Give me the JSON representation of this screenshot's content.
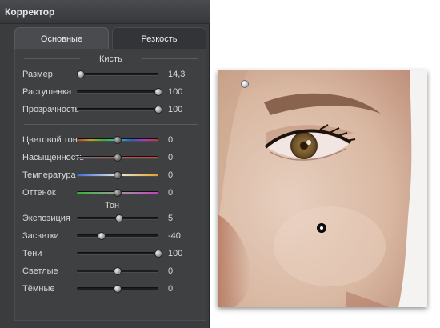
{
  "app": {
    "title": "Корректор"
  },
  "tabs": [
    {
      "label": "Основные",
      "active": true
    },
    {
      "label": "Резкость",
      "active": false
    }
  ],
  "sections": {
    "brush": "Кисть",
    "tone": "Тон"
  },
  "brush_rows": [
    {
      "label": "Размер",
      "value": "14,3",
      "level": 0.05
    },
    {
      "label": "Растушевка",
      "value": "100",
      "level": 1.0
    },
    {
      "label": "Прозрачность",
      "value": "100",
      "level": 1.0
    }
  ],
  "color_rows": [
    {
      "label": "Цветовой тон",
      "value": "0",
      "level": 0.5,
      "style": "hue"
    },
    {
      "label": "Насыщенность",
      "value": "0",
      "level": 0.5,
      "style": "sat"
    },
    {
      "label": "Температура",
      "value": "0",
      "level": 0.5,
      "style": "temp"
    },
    {
      "label": "Оттенок",
      "value": "0",
      "level": 0.5,
      "style": "tint"
    }
  ],
  "tone_rows": [
    {
      "label": "Экспозиция",
      "value": "5",
      "level": 0.52
    },
    {
      "label": "Засветки",
      "value": "-40",
      "level": 0.3
    },
    {
      "label": "Тени",
      "value": "100",
      "level": 1.0
    },
    {
      "label": "Светлые",
      "value": "0",
      "level": 0.5
    },
    {
      "label": "Тёмные",
      "value": "0",
      "level": 0.5
    }
  ],
  "colors": {
    "panel_bg": "#3b3c3e",
    "skin": "#d6b9a6",
    "iris": "#7a5a2e"
  },
  "photo": {
    "subject": "close-up face portrait (eye and cheek)"
  }
}
